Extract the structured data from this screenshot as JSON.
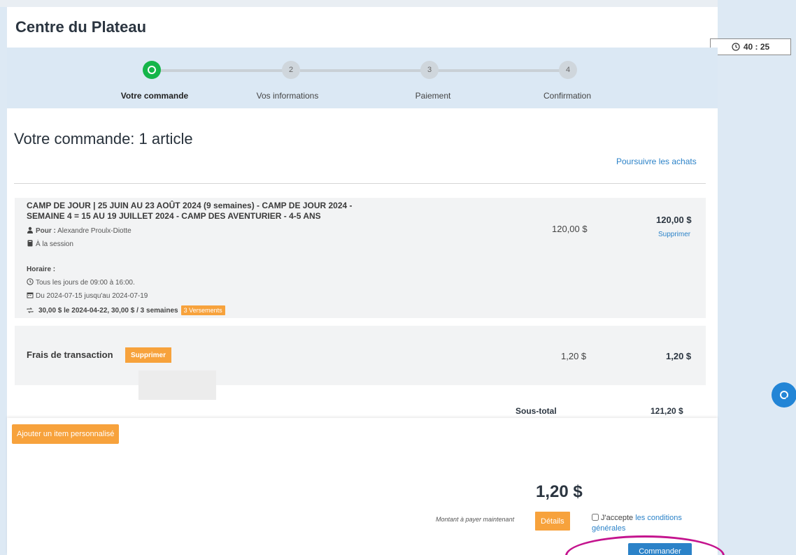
{
  "header": {
    "title": "Centre du Plateau"
  },
  "timer": {
    "value": "40 : 25",
    "icon": "clock-icon"
  },
  "steps": [
    {
      "number": "",
      "label": "Votre commande",
      "active": true
    },
    {
      "number": "2",
      "label": "Vos informations",
      "active": false
    },
    {
      "number": "3",
      "label": "Paiement",
      "active": false
    },
    {
      "number": "4",
      "label": "Confirmation",
      "active": false
    }
  ],
  "main": {
    "title": "Votre commande: 1 article",
    "continue_link": "Poursuivre les achats"
  },
  "item": {
    "title": "CAMP DE JOUR | 25 JUIN AU 23 AOÛT 2024 (9 semaines) - CAMP DE JOUR 2024 - SEMAINE 4 = 15 AU 19 JUILLET 2024 - CAMP DES AVENTURIER - 4-5 ANS",
    "for_label": "Pour :",
    "for_value": "Alexandre Proulx-Diotte",
    "session": "À la session",
    "schedule_label": "Horaire :",
    "schedule_time": "Tous les jours de 09:00 à 16:00.",
    "schedule_dates": "Du 2024-07-15 jusqu'au 2024-07-19",
    "payment_plan": "30,00 $ le 2024-04-22, 30,00 $ / 3 semaines",
    "installments_badge": "3 Versements",
    "unit_price": "120,00 $",
    "total_price": "120,00 $",
    "delete_label": "Supprimer"
  },
  "fee": {
    "label": "Frais de transaction",
    "delete_label": "Supprimer",
    "unit_price": "1,20 $",
    "total_price": "1,20 $"
  },
  "subtotal": {
    "label": "Sous-total",
    "value": "121,20 $"
  },
  "bottom": {
    "add_item_label": "Ajouter un item personnalisé",
    "pay_amount": "1,20 $",
    "pay_note": "Montant à payer maintenant",
    "details_label": "Détails",
    "terms_prefix": "J'accepte",
    "terms_link": "les conditions générales",
    "order_label": "Commander"
  },
  "colors": {
    "accent_blue": "#2b82c8",
    "accent_orange": "#f7a23c",
    "active_step_green": "#15b54a",
    "highlight_magenta": "#c4148e"
  }
}
